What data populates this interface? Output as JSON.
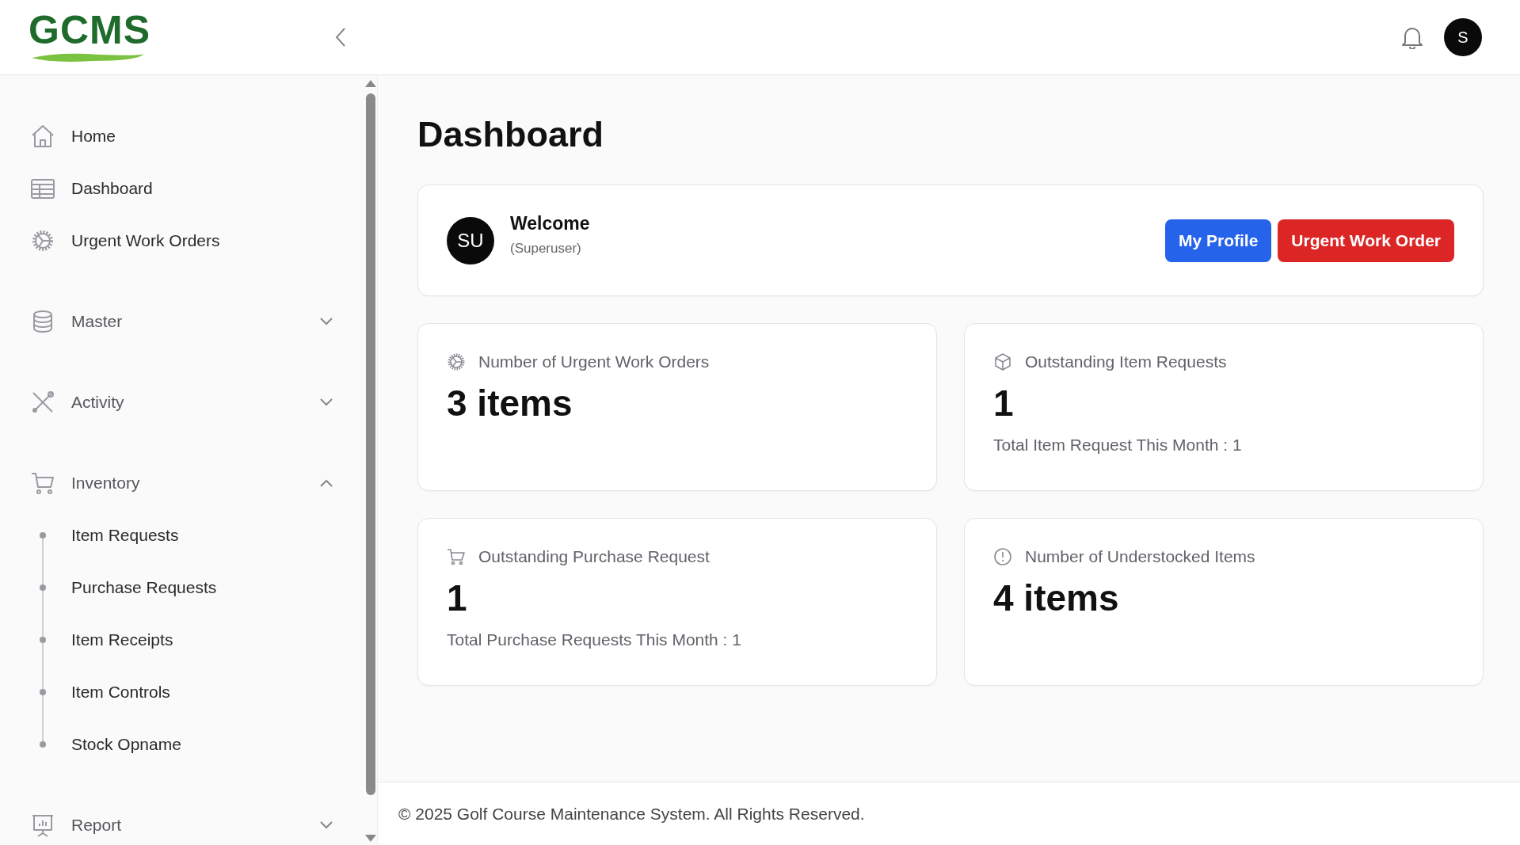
{
  "header": {
    "logo": "GCMS",
    "user_initial": "S"
  },
  "sidebar": {
    "items": [
      {
        "kind": "link",
        "label": "Home"
      },
      {
        "kind": "link",
        "label": "Dashboard"
      },
      {
        "kind": "link",
        "label": "Urgent Work Orders"
      },
      {
        "kind": "group",
        "label": "Master",
        "expanded": false
      },
      {
        "kind": "group",
        "label": "Activity",
        "expanded": false
      },
      {
        "kind": "group",
        "label": "Inventory",
        "expanded": true,
        "children": [
          {
            "label": "Item Requests"
          },
          {
            "label": "Purchase Requests"
          },
          {
            "label": "Item Receipts"
          },
          {
            "label": "Item Controls"
          },
          {
            "label": "Stock Opname"
          }
        ]
      },
      {
        "kind": "group",
        "label": "Report",
        "expanded": false
      }
    ]
  },
  "page": {
    "title": "Dashboard"
  },
  "welcome": {
    "initials": "SU",
    "greeting": "Welcome",
    "role": "(Superuser)",
    "buttons": [
      {
        "label": "My Profile",
        "kind": "primary"
      },
      {
        "label": "Urgent Work Order",
        "kind": "danger"
      }
    ]
  },
  "stats": [
    {
      "title": "Number of Urgent Work Orders",
      "value": "3 items"
    },
    {
      "title": "Outstanding Item Requests",
      "value": "1",
      "note": "Total Item Request This Month : 1"
    },
    {
      "title": "Outstanding Purchase Request",
      "value": "1",
      "note": "Total Purchase Requests This Month : 1"
    },
    {
      "title": "Number of Understocked Items",
      "value": "4 items"
    }
  ],
  "footer": {
    "text": "© 2025 Golf Course Maintenance System. All Rights Reserved."
  }
}
